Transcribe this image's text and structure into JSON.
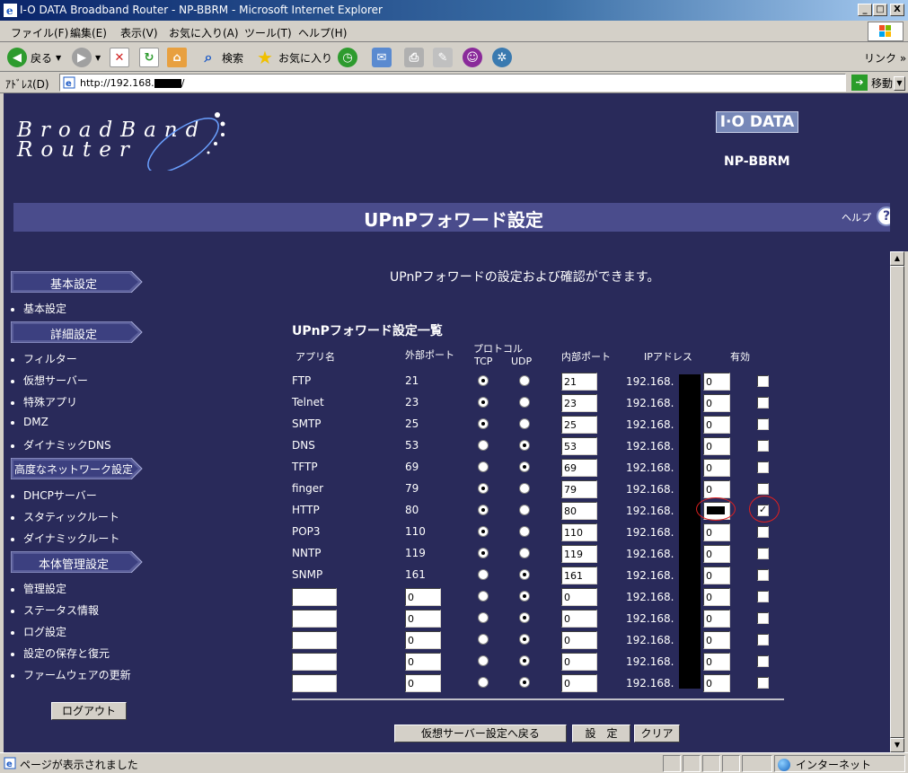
{
  "window": {
    "title": "I-O DATA Broadband Router - NP-BBRM - Microsoft Internet Explorer",
    "minimize": "_",
    "maximize": "□",
    "close": "X"
  },
  "menu": [
    "ファイル(F)",
    "編集(E)",
    "表示(V)",
    "お気に入り(A)",
    "ツール(T)",
    "ヘルプ(H)"
  ],
  "toolbar": {
    "back": "戻る",
    "search": "検索",
    "favorites": "お気に入り",
    "links": "リンク »"
  },
  "address": {
    "label": "ｱﾄﾞﾚｽ(D)",
    "url": "http://192.168.",
    "url_tail": "/",
    "go": "移動"
  },
  "logo": {
    "line1": "BroadBand",
    "line2": "Router",
    "brand": "I·O DATA",
    "model": "NP-BBRM"
  },
  "page": {
    "title": "UPnPフォワード設定",
    "help": "ヘルプ",
    "help_icon": "?",
    "description": "UPnPフォワードの設定および確認ができます。",
    "section_title": "UPnPフォワード設定一覧"
  },
  "sidebar": {
    "sections": [
      {
        "title": "基本設定",
        "items": [
          "基本設定"
        ]
      },
      {
        "title": "詳細設定",
        "items": [
          "フィルター",
          "仮想サーバー",
          "特殊アプリ",
          "DMZ",
          "ダイナミックDNS"
        ]
      },
      {
        "title": "高度なネットワーク設定",
        "items": [
          "DHCPサーバー",
          "スタティックルート",
          "ダイナミックルート"
        ]
      },
      {
        "title": "本体管理設定",
        "items": [
          "管理設定",
          "ステータス情報",
          "ログ設定",
          "設定の保存と復元",
          "ファームウェアの更新"
        ]
      }
    ],
    "logout": "ログアウト"
  },
  "table": {
    "headers": {
      "app": "アプリ名",
      "ext_port": "外部ポート",
      "protocol": "プロトコル",
      "tcp": "TCP",
      "udp": "UDP",
      "int_port": "内部ポート",
      "ip": "IPアドレス",
      "enabled": "有効"
    },
    "ip_prefix": "192.168.",
    "rows": [
      {
        "app": "FTP",
        "ext": "21",
        "protocol": "TCP",
        "int": "21",
        "ip_last": "0",
        "enabled": false
      },
      {
        "app": "Telnet",
        "ext": "23",
        "protocol": "TCP",
        "int": "23",
        "ip_last": "0",
        "enabled": false
      },
      {
        "app": "SMTP",
        "ext": "25",
        "protocol": "TCP",
        "int": "25",
        "ip_last": "0",
        "enabled": false
      },
      {
        "app": "DNS",
        "ext": "53",
        "protocol": "UDP",
        "int": "53",
        "ip_last": "0",
        "enabled": false
      },
      {
        "app": "TFTP",
        "ext": "69",
        "protocol": "UDP",
        "int": "69",
        "ip_last": "0",
        "enabled": false
      },
      {
        "app": "finger",
        "ext": "79",
        "protocol": "TCP",
        "int": "79",
        "ip_last": "0",
        "enabled": false
      },
      {
        "app": "HTTP",
        "ext": "80",
        "protocol": "TCP",
        "int": "80",
        "ip_last": "",
        "enabled": true
      },
      {
        "app": "POP3",
        "ext": "110",
        "protocol": "TCP",
        "int": "110",
        "ip_last": "0",
        "enabled": false
      },
      {
        "app": "NNTP",
        "ext": "119",
        "protocol": "TCP",
        "int": "119",
        "ip_last": "0",
        "enabled": false
      },
      {
        "app": "SNMP",
        "ext": "161",
        "protocol": "UDP",
        "int": "161",
        "ip_last": "0",
        "enabled": false
      },
      {
        "app": "",
        "ext": "0",
        "protocol": "UDP",
        "int": "0",
        "ip_last": "0",
        "enabled": false
      },
      {
        "app": "",
        "ext": "0",
        "protocol": "UDP",
        "int": "0",
        "ip_last": "0",
        "enabled": false
      },
      {
        "app": "",
        "ext": "0",
        "protocol": "UDP",
        "int": "0",
        "ip_last": "0",
        "enabled": false
      },
      {
        "app": "",
        "ext": "0",
        "protocol": "UDP",
        "int": "0",
        "ip_last": "0",
        "enabled": false
      },
      {
        "app": "",
        "ext": "0",
        "protocol": "UDP",
        "int": "0",
        "ip_last": "0",
        "enabled": false
      }
    ]
  },
  "buttons": {
    "back_to_vserver": "仮想サーバー設定へ戻る",
    "apply": "設　定",
    "clear": "クリア"
  },
  "status": {
    "text": "ページが表示されました",
    "zone": "インターネット"
  },
  "colors": {
    "content_bg": "#292a5a",
    "title_band": "#4a4c8c",
    "highlight": "#e02020"
  }
}
